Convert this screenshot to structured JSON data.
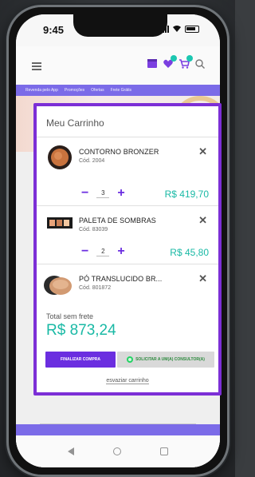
{
  "status_bar": {
    "time": "9:45"
  },
  "promo_bar": {
    "items": [
      "Revenda pelo App",
      "Promoções",
      "Ofertas",
      "Frete Grátis"
    ]
  },
  "cart": {
    "title": "Meu Carrinho",
    "items": [
      {
        "name": "CONTORNO BRONZER",
        "code": "Cód. 2004",
        "qty": "3",
        "price": "R$ 419,70"
      },
      {
        "name": "PALETA DE SOMBRAS",
        "code": "Cód. 83039",
        "qty": "2",
        "price": "R$ 45,80"
      },
      {
        "name": "PÓ TRANSLUCIDO BR...",
        "code": "Cód. 801872"
      }
    ],
    "total_label": "Total sem frete",
    "total_value": "R$ 873,24",
    "finish_label": "FINALIZAR COMPRA",
    "whatsapp_label": "SOLICITAR A UM(A) CONSULTOR(A)",
    "empty_label": "esvaziar carrinho"
  },
  "colors": {
    "accent_purple": "#6b2ee0",
    "frame_purple": "#7c2fd6",
    "price_teal": "#19b9a5"
  },
  "icons": [
    "hamburger-icon",
    "store-icon",
    "heart-icon",
    "cart-icon",
    "search-icon",
    "close-icon",
    "minus-icon",
    "plus-icon",
    "whatsapp-icon"
  ]
}
